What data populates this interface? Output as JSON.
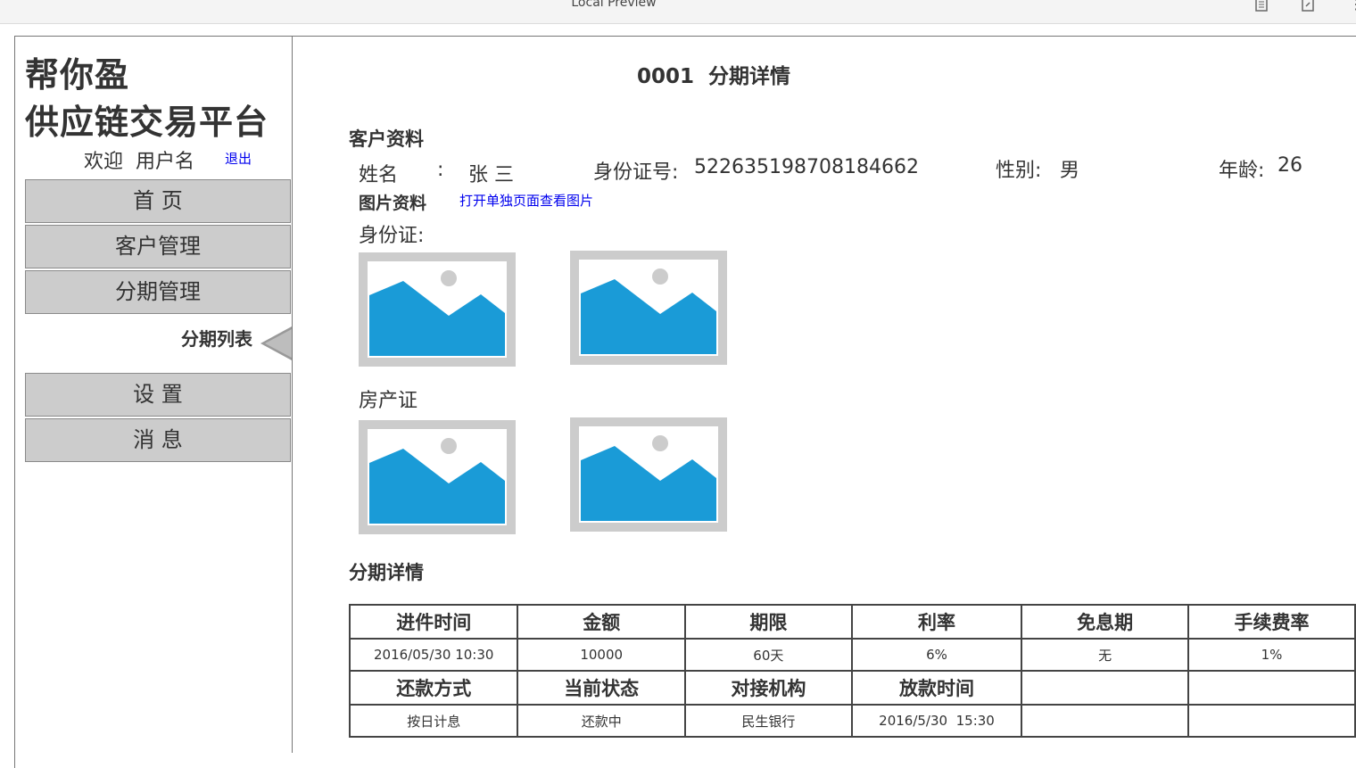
{
  "window": {
    "title": "Local Preview"
  },
  "toolbar_icons": [
    "document-icon",
    "export-icon",
    "more-icon"
  ],
  "sidebar": {
    "brand_line1": "帮你盈",
    "brand_line2": "供应链交易平台",
    "welcome": "欢迎  用户名",
    "logout": "退出",
    "items": [
      {
        "label": "首 页"
      },
      {
        "label": "客户管理"
      },
      {
        "label": "分期管理"
      },
      {
        "label": "设 置"
      },
      {
        "label": "消 息"
      }
    ],
    "active_subitem": "分期列表"
  },
  "main": {
    "title": "0001  分期详情",
    "customer_section": "客户资料",
    "name_label": "姓名",
    "name_sep": ":",
    "name_value": "张 三",
    "id_label": "身份证号:",
    "id_value": "522635198708184662",
    "gender_label": "性别:",
    "gender_value": "男",
    "age_label": "年龄:",
    "age_value": "26",
    "images_label": "图片资料",
    "images_link": "打开单独页面查看图片",
    "id_card_label": "身份证:",
    "property_label": "房产证",
    "installment_section": "分期详情",
    "table": {
      "headers1": [
        "进件时间",
        "金额",
        "期限",
        "利率",
        "免息期",
        "手续费率"
      ],
      "values1": [
        "2016/05/30 10:30",
        "10000",
        "60天",
        "6%",
        "无",
        "1%"
      ],
      "headers2": [
        "还款方式",
        "当前状态",
        "对接机构",
        "放款时间",
        "",
        ""
      ],
      "values2": [
        "按日计息",
        "还款中",
        "民生银行",
        "2016/5/30  15:30",
        "",
        ""
      ]
    }
  },
  "colors": {
    "nav_bg": "#cccccc",
    "image_blue": "#1a9bd7",
    "link": "#0000ee"
  }
}
